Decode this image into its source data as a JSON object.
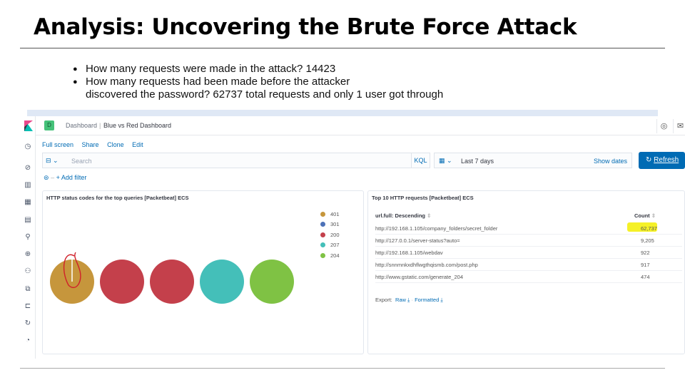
{
  "slide": {
    "title": "Analysis: Uncovering the Brute Force Attack",
    "bullets": [
      "How many requests were made in the attack? 14423",
      "How many requests had been made before the attacker",
      "discovered the password? 62737 total requests and only 1 user got through"
    ]
  },
  "kibana": {
    "space_letter": "D",
    "breadcrumb_root": "Dashboard",
    "breadcrumb_current": "Blue vs Red Dashboard",
    "menu": [
      "Full screen",
      "Share",
      "Clone",
      "Edit"
    ],
    "search_placeholder": "Search",
    "kql_label": "KQL",
    "date_range": "Last 7 days",
    "show_dates": "Show dates",
    "refresh_label": "Refresh",
    "add_filter": "+ Add filter",
    "pie_panel": {
      "title": "HTTP status codes for the top queries [Packetbeat] ECS",
      "legend": [
        {
          "label": "401",
          "color": "#c6963c"
        },
        {
          "label": "301",
          "color": "#4d72b8"
        },
        {
          "label": "200",
          "color": "#c4404b"
        },
        {
          "label": "207",
          "color": "#44bfb9"
        },
        {
          "label": "204",
          "color": "#7fc244"
        }
      ]
    },
    "table_panel": {
      "title": "Top 10 HTTP requests [Packetbeat] ECS",
      "col_url": "url.full: Descending",
      "col_count": "Count",
      "rows": [
        {
          "url": "http://192.168.1.105/company_folders/secret_folder",
          "count": "62,737"
        },
        {
          "url": "http://127.0.0.1/server-status?auto=",
          "count": "9,205"
        },
        {
          "url": "http://192.168.1.105/webdav",
          "count": "922"
        },
        {
          "url": "http://snnmnkxdhflwgthqismb.com/post.php",
          "count": "917"
        },
        {
          "url": "http://www.gstatic.com/generate_204",
          "count": "474"
        }
      ],
      "export_label": "Export:",
      "export_raw": "Raw",
      "export_formatted": "Formatted"
    }
  }
}
